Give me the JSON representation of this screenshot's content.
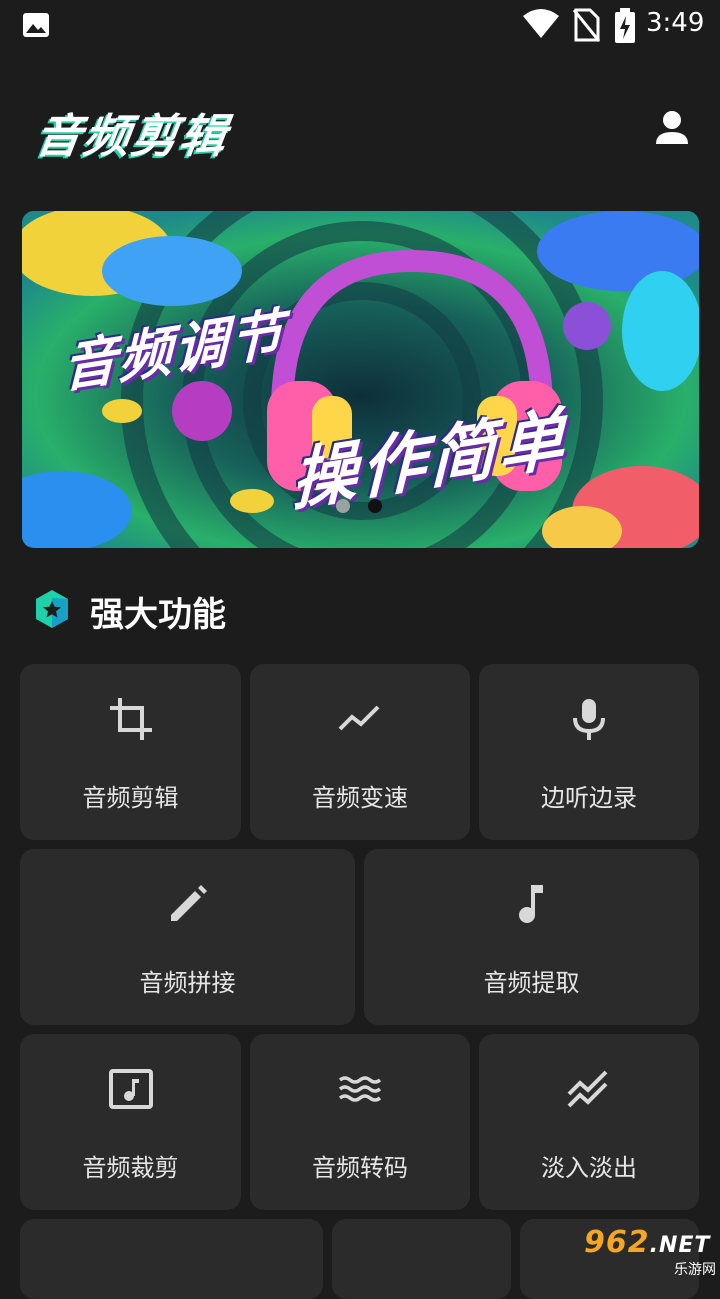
{
  "status_bar": {
    "time": "3:49",
    "icons": [
      "image-icon",
      "wifi-icon",
      "no-sim-icon",
      "battery-charging-icon"
    ]
  },
  "header": {
    "title": "音频剪辑",
    "user_icon": "person-icon"
  },
  "banner": {
    "line1": "音频调节",
    "line2": "操作简单",
    "active_slide": 2,
    "slide_count": 2
  },
  "section": {
    "title": "强大功能",
    "badge_icon": "star-hexagon-icon"
  },
  "features": [
    {
      "label": "音频剪辑",
      "icon": "crop-icon"
    },
    {
      "label": "音频变速",
      "icon": "trending-icon"
    },
    {
      "label": "边听边录",
      "icon": "microphone-icon"
    },
    {
      "label": "音频拼接",
      "icon": "pencil-icon"
    },
    {
      "label": "音频提取",
      "icon": "music-note-icon"
    },
    {
      "label": "音频裁剪",
      "icon": "music-box-icon"
    },
    {
      "label": "音频转码",
      "icon": "waves-icon"
    },
    {
      "label": "淡入淡出",
      "icon": "fade-icon"
    }
  ],
  "watermark": {
    "logo": "962",
    "suffix": ".NET",
    "sub": "乐游网"
  },
  "colors": {
    "background": "#1c1c1c",
    "tile": "#2b2b2b",
    "accent": "#1fd1a8",
    "text": "#ffffff"
  }
}
